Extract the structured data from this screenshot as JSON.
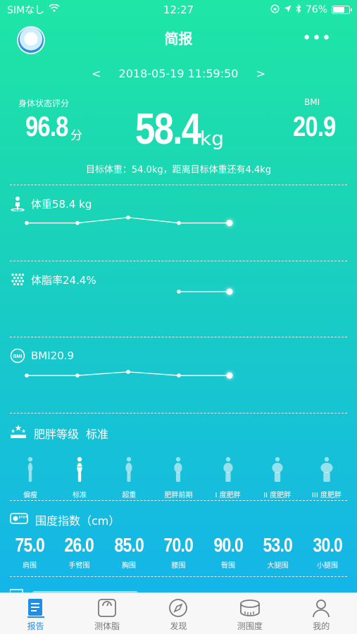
{
  "status_bar": {
    "carrier": "SIMなし",
    "time": "12:27",
    "battery": "76%",
    "battery_level": 0.76
  },
  "nav": {
    "title": "简报",
    "more": "•••"
  },
  "summary": {
    "prev": "<",
    "next": ">",
    "datetime": "2018-05-19 11:59:50",
    "score_label": "身体状态评分",
    "score_value": "96.8",
    "score_unit": "分",
    "weight_value": "58.4",
    "weight_unit": "kg",
    "bmi_label": "BMI",
    "bmi_value": "20.9",
    "goal_text": "目标体重：54.0kg，距离目标体重还有4.4kg"
  },
  "metrics": {
    "weight": {
      "label": "体重58.4 kg",
      "trend": [
        58.4,
        58.4,
        58.7,
        58.4,
        58.4
      ]
    },
    "body_fat": {
      "label": "体脂率24.4%",
      "trend": [
        null,
        null,
        null,
        24.4,
        24.4
      ]
    },
    "bmi": {
      "label": "BMI20.9",
      "icon_text": "BMI",
      "trend": [
        20.9,
        20.9,
        21.1,
        20.9,
        20.9
      ]
    }
  },
  "obesity": {
    "title": "肥胖等级",
    "status": "标准",
    "levels": [
      "偏瘦",
      "标准",
      "超重",
      "肥胖前期",
      "I 度肥胖",
      "II 度肥胖",
      "III 度肥胖"
    ],
    "active_index": 1
  },
  "girth": {
    "title": "围度指数（cm）",
    "items": [
      {
        "value": "75.0",
        "label": "肩围"
      },
      {
        "value": "26.0",
        "label": "手臂围"
      },
      {
        "value": "85.0",
        "label": "胸围"
      },
      {
        "value": "70.0",
        "label": "腰围"
      },
      {
        "value": "90.0",
        "label": "臀围"
      },
      {
        "value": "53.0",
        "label": "大腿围"
      },
      {
        "value": "30.0",
        "label": "小腿围"
      }
    ]
  },
  "tabs": [
    {
      "label": "报告",
      "icon": "report-icon",
      "active": true
    },
    {
      "label": "测体脂",
      "icon": "scale-icon",
      "active": false
    },
    {
      "label": "发现",
      "icon": "compass-icon",
      "active": false
    },
    {
      "label": "测围度",
      "icon": "tape-measure-icon",
      "active": false
    },
    {
      "label": "我的",
      "icon": "person-icon",
      "active": false
    }
  ],
  "colors": {
    "accent": "#1e8ee6",
    "gradient_top": "#1fe6a6",
    "gradient_bottom": "#14b2ee"
  }
}
